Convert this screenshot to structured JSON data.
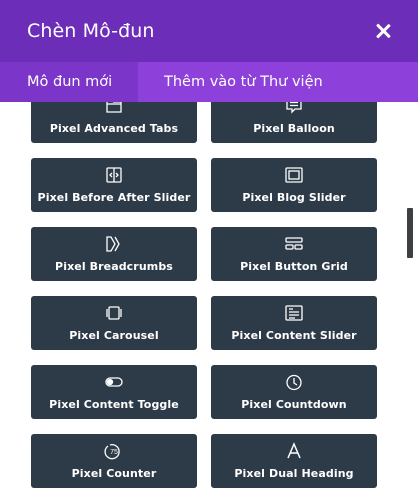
{
  "header": {
    "title": "Chèn Mô-đun"
  },
  "tabs": [
    {
      "label": "Mô đun mới"
    },
    {
      "label": "Thêm vào từ Thư viện"
    }
  ],
  "modules": [
    {
      "label": "Pixel Advanced Tabs",
      "icon": "tabs-icon"
    },
    {
      "label": "Pixel Balloon",
      "icon": "balloon-icon"
    },
    {
      "label": "Pixel Before After Slider",
      "icon": "before-after-icon"
    },
    {
      "label": "Pixel Blog Slider",
      "icon": "blog-slider-icon"
    },
    {
      "label": "Pixel Breadcrumbs",
      "icon": "breadcrumbs-icon"
    },
    {
      "label": "Pixel Button Grid",
      "icon": "button-grid-icon"
    },
    {
      "label": "Pixel Carousel",
      "icon": "carousel-icon"
    },
    {
      "label": "Pixel Content Slider",
      "icon": "content-slider-icon"
    },
    {
      "label": "Pixel Content Toggle",
      "icon": "toggle-icon"
    },
    {
      "label": "Pixel Countdown",
      "icon": "countdown-icon"
    },
    {
      "label": "Pixel Counter",
      "icon": "counter-icon"
    },
    {
      "label": "Pixel Dual Heading",
      "icon": "dual-heading-icon"
    }
  ]
}
